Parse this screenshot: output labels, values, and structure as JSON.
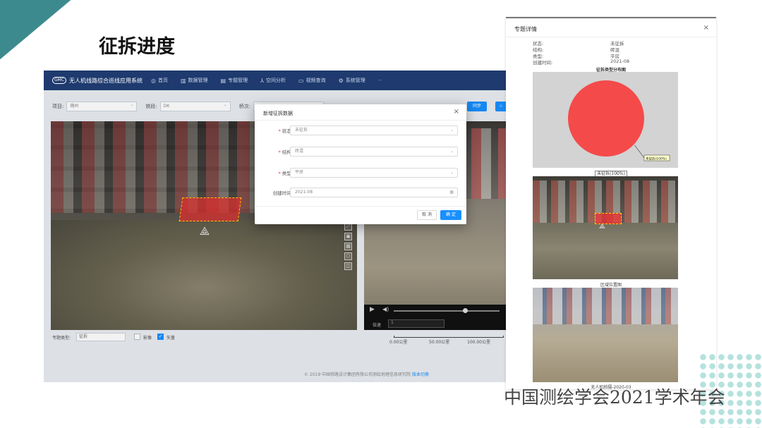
{
  "slide": {
    "title": "征拆进度",
    "conference": "中国测绘学会2021学术年会"
  },
  "app": {
    "logo_text": "GMC",
    "name": "无人机线路综合巡线应用系统",
    "nav": [
      {
        "label": "首页",
        "icon": "home-icon"
      },
      {
        "label": "数据管理",
        "icon": "chart-icon"
      },
      {
        "label": "专题管理",
        "icon": "doc-icon"
      },
      {
        "label": "空间分析",
        "icon": "analysis-icon"
      },
      {
        "label": "视频查询",
        "icon": "video-icon"
      },
      {
        "label": "系统管理",
        "icon": "settings-icon"
      },
      {
        "label": "··",
        "icon": ""
      }
    ],
    "filters": [
      {
        "label": "项目:",
        "value": "随州"
      },
      {
        "label": "铁段:",
        "value": "DK"
      },
      {
        "label": "桥次:",
        "value": ""
      }
    ],
    "top_buttons": [
      "同步",
      "☆"
    ],
    "video": {
      "speed_label": "倍速",
      "speed_value": "1"
    },
    "bottom": {
      "topic_label": "专题类型:",
      "topic_value": "征拆",
      "check1_label": "影像",
      "check2_label": "矢量"
    },
    "scale": [
      "0.00公里",
      "50.00公里",
      "100.00公里"
    ],
    "footer": "© 2019 中国铁路设计集团有限公司测绘地理信息研究院",
    "footer_link": "版本切换"
  },
  "modal": {
    "title": "新增征拆数据",
    "fields": [
      {
        "label": "状态:",
        "required": "*",
        "value": "未征拆",
        "kind": "select"
      },
      {
        "label": "结构:",
        "required": "*",
        "value": "砖混",
        "kind": "select"
      },
      {
        "label": "类型:",
        "required": "*",
        "value": "平房",
        "kind": "select"
      },
      {
        "label": "创建时间:",
        "required": "",
        "value": "2021-08",
        "kind": "date"
      }
    ],
    "cancel": "取 消",
    "ok": "确 定"
  },
  "panel": {
    "title": "专题详情",
    "info": [
      {
        "k": "状态:",
        "v": "未征拆"
      },
      {
        "k": "结构:",
        "v": "砖混"
      },
      {
        "k": "类型:",
        "v": "平房"
      },
      {
        "k": "创建时间:",
        "v": "2021-08"
      }
    ],
    "photo1_caption": "区域位置图",
    "photo2_caption": "无人机拍摄-2020-03"
  },
  "chart_data": {
    "type": "pie",
    "title": "征拆类型分布图",
    "categories": [
      "未征拆"
    ],
    "values": [
      100
    ],
    "legend": [
      "未征拆(100%)"
    ],
    "colors": [
      "#f54a4a"
    ],
    "slice_labels": [
      "未征拆(100%)"
    ]
  }
}
